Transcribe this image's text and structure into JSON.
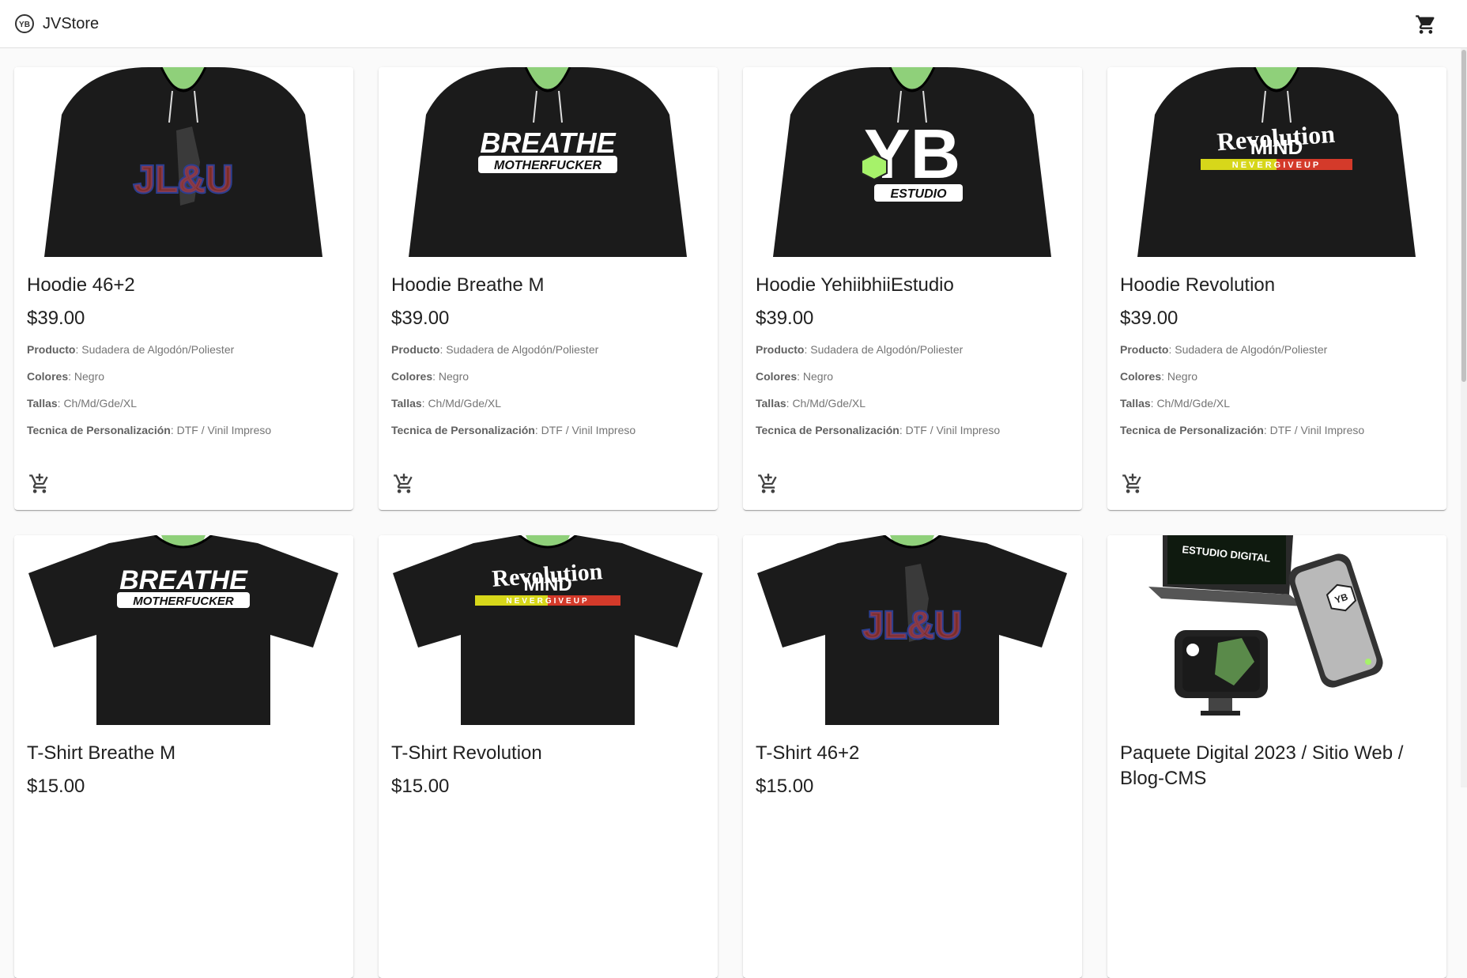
{
  "app": {
    "title": "JVStore",
    "cart_icon": "shopping-cart-icon"
  },
  "spec_labels": {
    "producto": "Producto",
    "colores": "Colores",
    "tallas": "Tallas",
    "tecnica": "Tecnica de Personalización"
  },
  "products": [
    {
      "title": "Hoodie 46+2",
      "price": "$39.00",
      "producto": "Sudadera de Algodón/Poliester",
      "colores": "Negro",
      "tallas": "Ch/Md/Gde/XL",
      "tecnica": "DTF / Vinil Impreso",
      "image_kind": "hoodie",
      "design_text": "JL&U"
    },
    {
      "title": "Hoodie Breathe M",
      "price": "$39.00",
      "producto": "Sudadera de Algodón/Poliester",
      "colores": "Negro",
      "tallas": "Ch/Md/Gde/XL",
      "tecnica": "DTF / Vinil Impreso",
      "image_kind": "hoodie",
      "design_text": "BREATHE",
      "design_sub": "MOTHERFUCKER"
    },
    {
      "title": "Hoodie YehiibhiiEstudio",
      "price": "$39.00",
      "producto": "Sudadera de Algodón/Poliester",
      "colores": "Negro",
      "tallas": "Ch/Md/Gde/XL",
      "tecnica": "DTF / Vinil Impreso",
      "image_kind": "hoodie",
      "design_text": "YB",
      "design_sub": "ESTUDIO"
    },
    {
      "title": "Hoodie Revolution",
      "price": "$39.00",
      "producto": "Sudadera de Algodón/Poliester",
      "colores": "Negro",
      "tallas": "Ch/Md/Gde/XL",
      "tecnica": "DTF / Vinil Impreso",
      "image_kind": "hoodie",
      "design_text": "Revolution",
      "design_sub": "NEVERGIVEUP"
    },
    {
      "title": "T-Shirt Breathe M",
      "price": "$15.00",
      "image_kind": "tshirt",
      "design_text": "BREATHE",
      "design_sub": "MOTHERFUCKER"
    },
    {
      "title": "T-Shirt Revolution",
      "price": "$15.00",
      "image_kind": "tshirt",
      "design_text": "Revolution",
      "design_sub": "NEVERGIVEUP"
    },
    {
      "title": "T-Shirt 46+2",
      "price": "$15.00",
      "image_kind": "tshirt",
      "design_text": "JL&U"
    },
    {
      "title": "Paquete Digital 2023 / Sitio Web / Blog-CMS",
      "price": "",
      "image_kind": "digital",
      "design_text": "ESTUDIO DIGITAL",
      "design_sub": "YB"
    }
  ],
  "colors": {
    "garment": "#1b1b1b",
    "mannequin": "#8fd07a",
    "accent_red": "#c0392b",
    "accent_blue": "#2c3e8f",
    "lime": "#a6f26a"
  }
}
